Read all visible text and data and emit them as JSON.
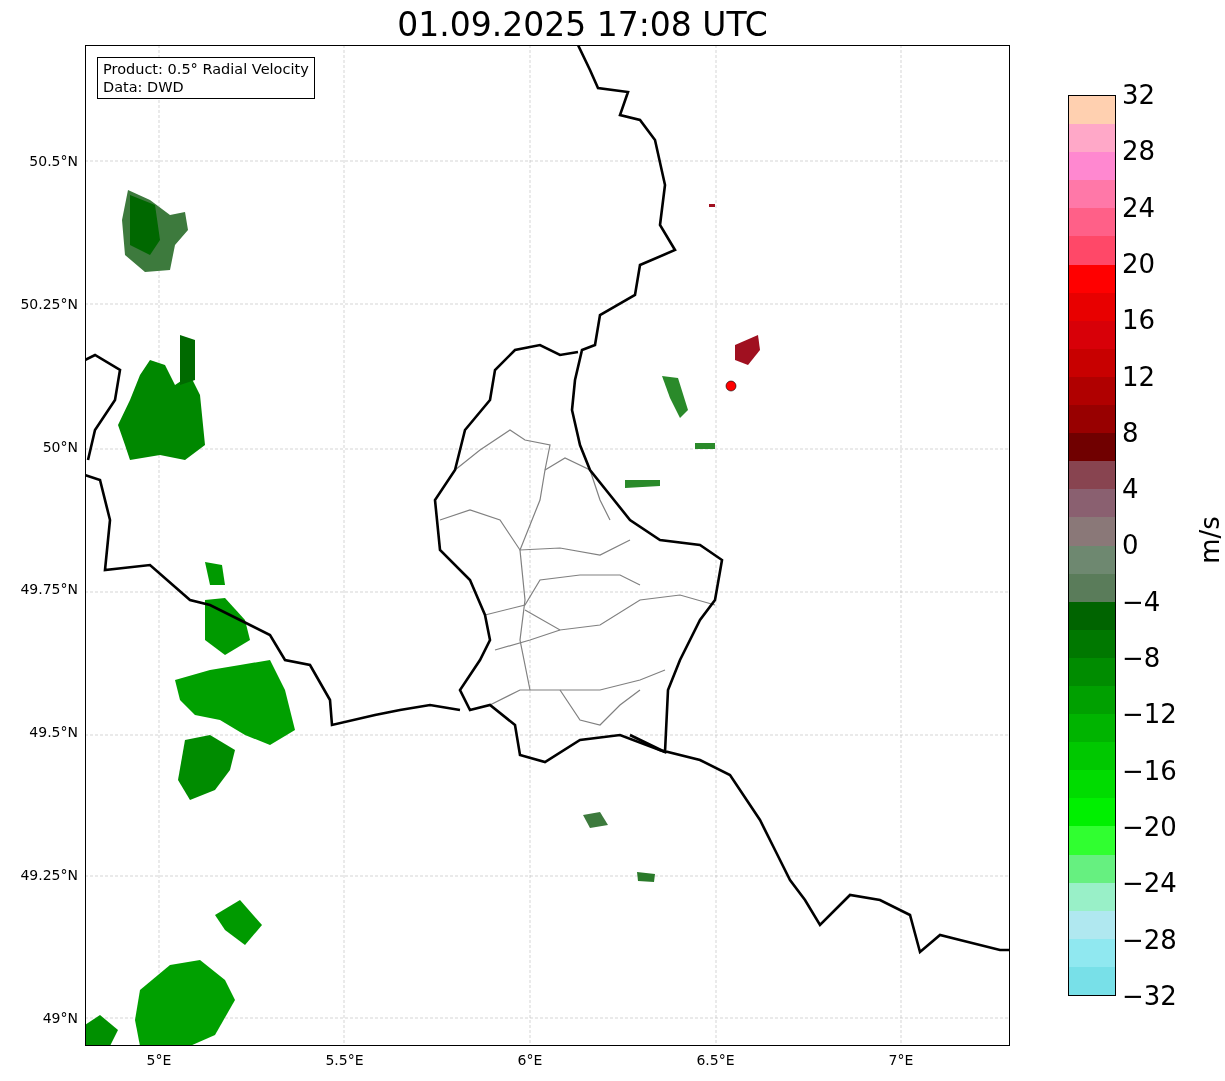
{
  "title": "01.09.2025 17:08 UTC",
  "info_box": {
    "lines": [
      "Product: 0.5° Radial Velocity",
      "Data: DWD"
    ]
  },
  "axes": {
    "yticks": [
      "50.5°N",
      "50.25°N",
      "50°N",
      "49.75°N",
      "49.5°N",
      "49.25°N",
      "49°N"
    ],
    "xticks": [
      "5°E",
      "5.5°E",
      "6°E",
      "6.5°E",
      "7°E"
    ]
  },
  "colorbar": {
    "label": "m/s",
    "ticks": [
      "32",
      "28",
      "24",
      "20",
      "16",
      "12",
      "8",
      "4",
      "0",
      "−4",
      "−8",
      "−12",
      "−16",
      "−20",
      "−24",
      "−28",
      "−32"
    ],
    "bands": [
      {
        "color": "#ffd0b0"
      },
      {
        "color": "#ffa8c8"
      },
      {
        "color": "#ff88d0"
      },
      {
        "color": "#ff78a8"
      },
      {
        "color": "#ff6088"
      },
      {
        "color": "#ff4868"
      },
      {
        "color": "#ff0000"
      },
      {
        "color": "#e80000"
      },
      {
        "color": "#d80008"
      },
      {
        "color": "#c80000"
      },
      {
        "color": "#b00000"
      },
      {
        "color": "#980000"
      },
      {
        "color": "#700000"
      },
      {
        "color": "#884450"
      },
      {
        "color": "#8a6070"
      },
      {
        "color": "#8a7878"
      },
      {
        "color": "#6e8870"
      },
      {
        "color": "#5a7c5a"
      },
      {
        "color": "#006400"
      },
      {
        "color": "#007800"
      },
      {
        "color": "#008c00"
      },
      {
        "color": "#00a000"
      },
      {
        "color": "#00b400"
      },
      {
        "color": "#00c800"
      },
      {
        "color": "#00dc00"
      },
      {
        "color": "#00f000"
      },
      {
        "color": "#30ff30"
      },
      {
        "color": "#66f080"
      },
      {
        "color": "#99f0c8"
      },
      {
        "color": "#b0e8f0"
      },
      {
        "color": "#90e8f0"
      },
      {
        "color": "#78e0e8"
      }
    ]
  }
}
